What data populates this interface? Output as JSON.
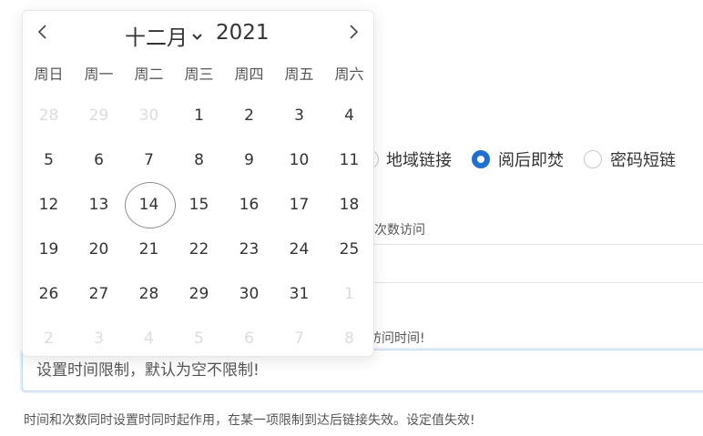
{
  "form": {
    "radios": [
      {
        "label": "地域链接",
        "checked": false
      },
      {
        "label": "阅后即焚",
        "checked": true
      },
      {
        "label": "密码短链",
        "checked": false
      }
    ],
    "count_label": "次数访问",
    "hint_top": "访问时间!",
    "time_input": {
      "value": "",
      "placeholder": "设置时间限制，默认为空不限制!"
    },
    "footer_note": "时间和次数同时设置时同时起作用，在某一项限制到达后链接失效。设定值失效!"
  },
  "calendar": {
    "month": "十二月",
    "year": "2021",
    "prev_icon": "chevron-left-icon",
    "next_icon": "chevron-right-icon",
    "weekdays": [
      "周日",
      "周一",
      "周二",
      "周三",
      "周四",
      "周五",
      "周六"
    ],
    "weeks": [
      [
        {
          "d": "28",
          "m": true
        },
        {
          "d": "29",
          "m": true
        },
        {
          "d": "30",
          "m": true
        },
        {
          "d": "1"
        },
        {
          "d": "2"
        },
        {
          "d": "3"
        },
        {
          "d": "4"
        }
      ],
      [
        {
          "d": "5"
        },
        {
          "d": "6"
        },
        {
          "d": "7"
        },
        {
          "d": "8"
        },
        {
          "d": "9"
        },
        {
          "d": "10"
        },
        {
          "d": "11"
        }
      ],
      [
        {
          "d": "12"
        },
        {
          "d": "13"
        },
        {
          "d": "14",
          "today": true
        },
        {
          "d": "15"
        },
        {
          "d": "16"
        },
        {
          "d": "17"
        },
        {
          "d": "18"
        }
      ],
      [
        {
          "d": "19"
        },
        {
          "d": "20"
        },
        {
          "d": "21"
        },
        {
          "d": "22"
        },
        {
          "d": "23"
        },
        {
          "d": "24"
        },
        {
          "d": "25"
        }
      ],
      [
        {
          "d": "26"
        },
        {
          "d": "27"
        },
        {
          "d": "28"
        },
        {
          "d": "29"
        },
        {
          "d": "30"
        },
        {
          "d": "31"
        },
        {
          "d": "1",
          "m": true
        }
      ],
      [
        {
          "d": "2",
          "m": true
        },
        {
          "d": "3",
          "m": true
        },
        {
          "d": "4",
          "m": true
        },
        {
          "d": "5",
          "m": true
        },
        {
          "d": "6",
          "m": true
        },
        {
          "d": "7",
          "m": true
        },
        {
          "d": "8",
          "m": true
        }
      ]
    ],
    "accent": "#1f6fd1"
  }
}
